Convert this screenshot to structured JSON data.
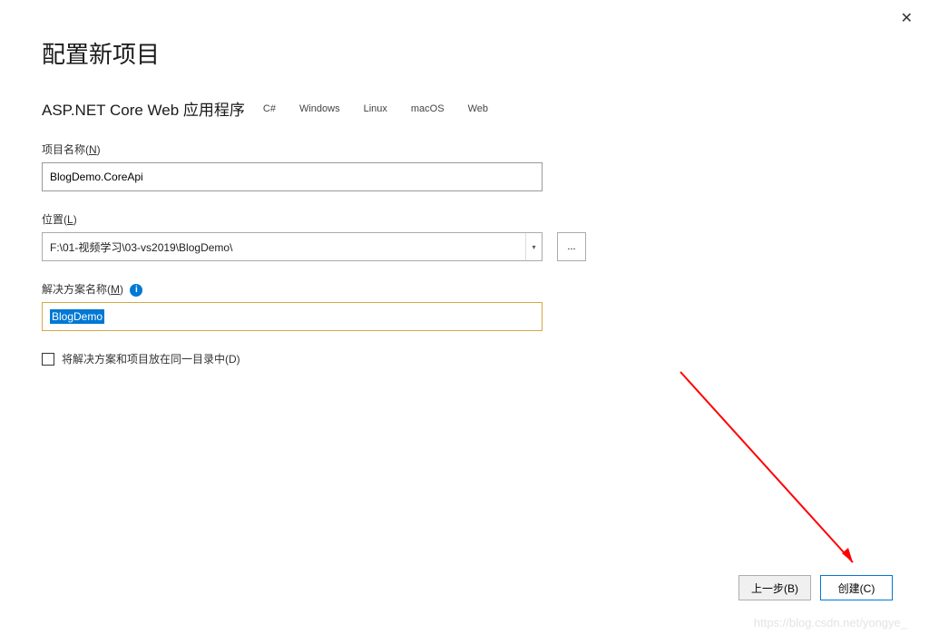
{
  "close_label": "✕",
  "title": "配置新项目",
  "subtitle": "ASP.NET Core Web 应用程序",
  "tags": [
    "C#",
    "Windows",
    "Linux",
    "macOS",
    "Web"
  ],
  "project_name": {
    "label_prefix": "项目名称(",
    "label_key": "N",
    "label_suffix": ")",
    "value": "BlogDemo.CoreApi"
  },
  "location": {
    "label_prefix": "位置(",
    "label_key": "L",
    "label_suffix": ")",
    "value": "F:\\01-视频学习\\03-vs2019\\BlogDemo\\",
    "browse": "..."
  },
  "solution_name": {
    "label_prefix": "解决方案名称(",
    "label_key": "M",
    "label_suffix": ")",
    "info": "i",
    "value": "BlogDemo"
  },
  "checkbox": {
    "label_prefix": "将解决方案和项目放在同一目录中(",
    "label_key": "D",
    "label_suffix": ")"
  },
  "buttons": {
    "back": "上一步(B)",
    "create": "创建(C)"
  },
  "watermark": "https://blog.csdn.net/yongye_"
}
